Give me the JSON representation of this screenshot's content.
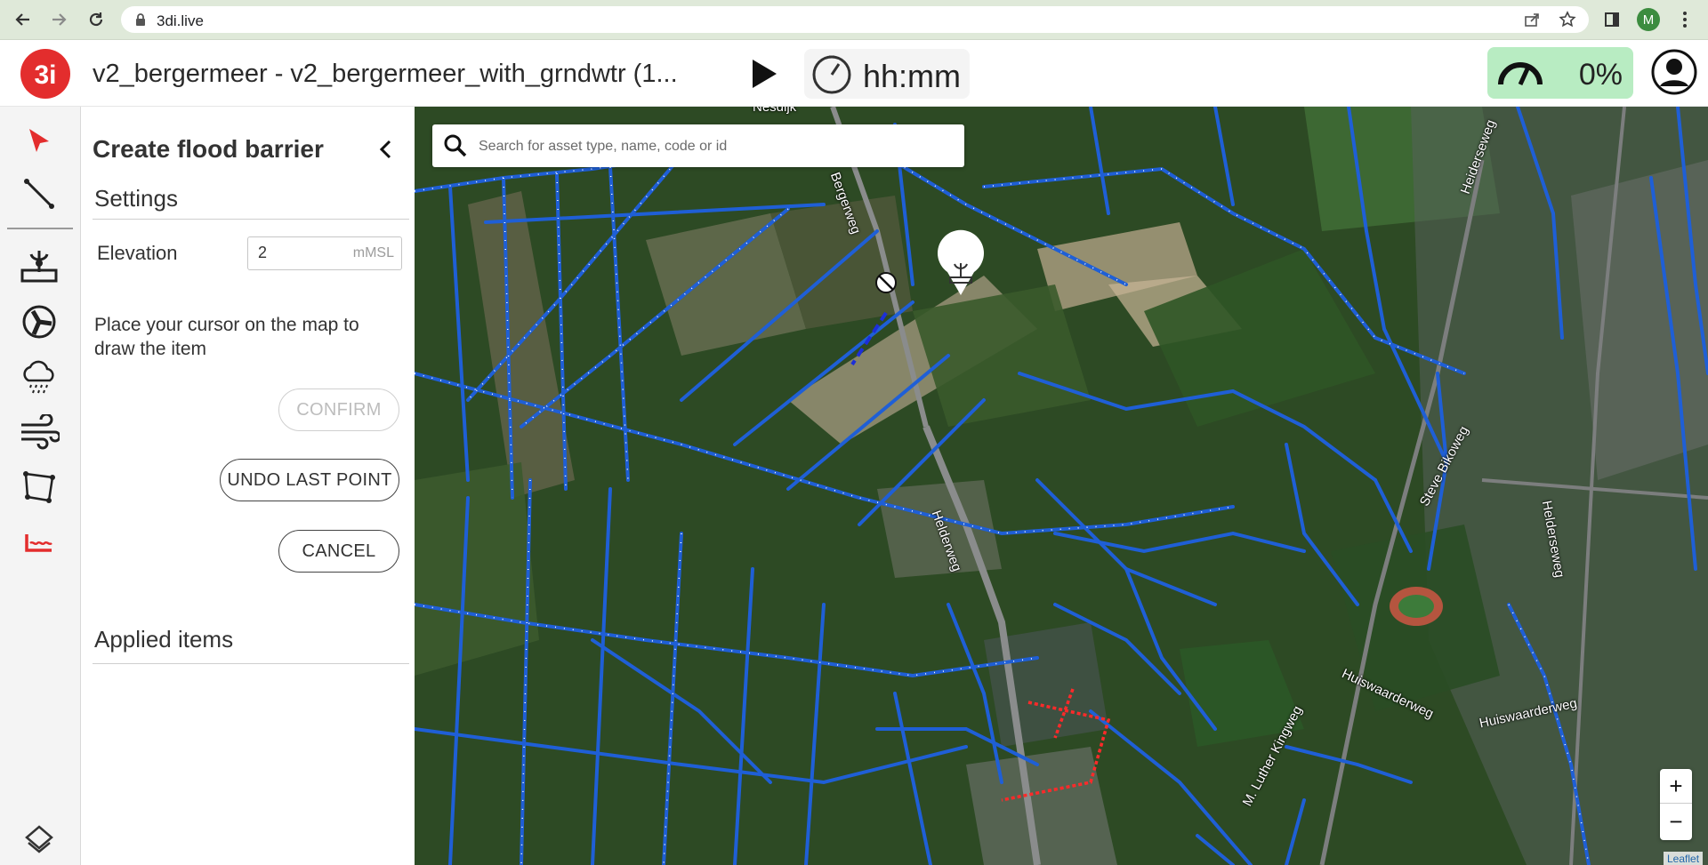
{
  "browser": {
    "url": "3di.live",
    "profile_initial": "M",
    "icons": [
      "back-icon",
      "forward-icon",
      "reload-icon",
      "lock-icon",
      "share-icon",
      "star-icon",
      "sidepanel-icon",
      "menu-icon"
    ]
  },
  "header": {
    "title": "v2_bergermeer - v2_bergermeer_with_grndwtr (1...",
    "time_display": "hh:mm",
    "speed_display": "0%",
    "colors": {
      "logo": "#e32d2d",
      "speed_bg": "#b8ecc2"
    }
  },
  "toolbar": {
    "tools": [
      "select-tool",
      "line-tool",
      "source-tool",
      "pump-tool",
      "rain-tool",
      "wind-tool",
      "polygon-tool",
      "flood-barrier-tool",
      "layers-tool"
    ],
    "active_color": "#e32d2d"
  },
  "panel": {
    "title": "Create flood barrier",
    "settings_heading": "Settings",
    "elevation_label": "Elevation",
    "elevation_value": "2",
    "elevation_unit": "mMSL",
    "instruction": "Place your cursor on the map to draw the item",
    "confirm_label": "CONFIRM",
    "undo_label": "UNDO LAST POINT",
    "cancel_label": "CANCEL",
    "applied_heading": "Applied items"
  },
  "map": {
    "search_placeholder": "Search for asset type, name, code or id",
    "zoom_in": "+",
    "zoom_out": "−",
    "attribution": "Leaflet",
    "road_labels": {
      "nesdijk": "Nesdijk",
      "bergerweg": "Bergerweg",
      "helderweg": "Helderweg",
      "heiderseweg": "Heiderseweg",
      "steve_biko": "Steve Bikoweg",
      "helderseweg": "Helderseweg",
      "huiswaarder1": "Huiswaarderweg",
      "huiswaarder2": "Huiswaarderweg",
      "mlk": "M. Luther Kingweg"
    },
    "channel_color": "#1f5fd6",
    "barrier_color": "#1c2fd8",
    "breach_color": "#ff2a2a"
  }
}
